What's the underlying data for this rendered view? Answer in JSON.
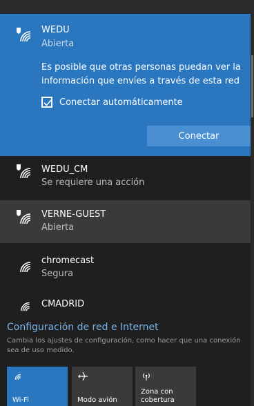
{
  "networks": [
    {
      "name": "WEDU",
      "status": "Abierta",
      "warning": "Es posible que otras personas puedan ver la información que envíes a través de esta red",
      "auto_connect_label": "Conectar automáticamente",
      "auto_connect_checked": true,
      "connect_label": "Conectar",
      "icon": "wifi-shield-icon"
    },
    {
      "name": "WEDU_CM",
      "status": "Se requiere una acción",
      "icon": "wifi-shield-icon"
    },
    {
      "name": "VERNE-GUEST",
      "status": "Abierta",
      "icon": "wifi-shield-icon"
    },
    {
      "name": "chromecast",
      "status": "Segura",
      "icon": "wifi-icon"
    },
    {
      "name": "CMADRID",
      "status": "",
      "icon": "wifi-icon"
    }
  ],
  "settings": {
    "link": "Configuración de red e Internet",
    "description": "Cambia los ajustes de configuración, como hacer que una conexión sea de uso medido."
  },
  "quick_actions": [
    {
      "label": "Wi-Fi",
      "icon": "wifi-icon",
      "active": true
    },
    {
      "label": "Modo avión",
      "icon": "airplane-icon",
      "active": false
    },
    {
      "label": "Zona con cobertura",
      "icon": "hotspot-icon",
      "active": false
    }
  ],
  "colors": {
    "accent": "#2a77bf",
    "background": "#1f1f1f",
    "link": "#7ab4ea"
  }
}
